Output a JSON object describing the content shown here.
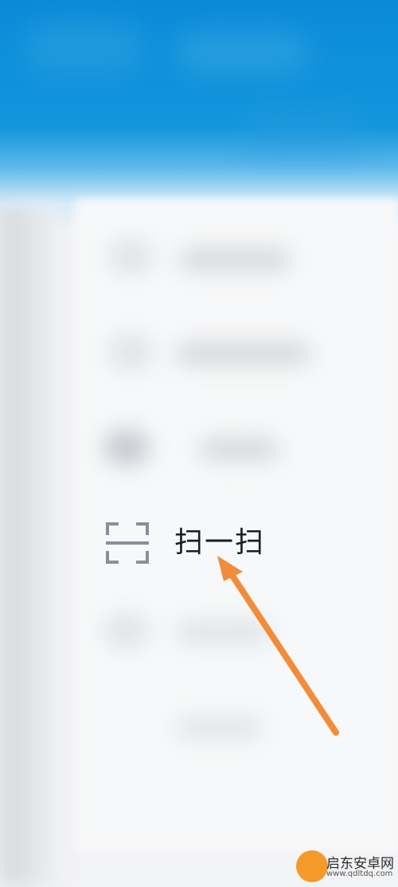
{
  "menu": {
    "scan_label": "扫一扫",
    "scan_icon": "scan-icon"
  },
  "annotation": {
    "arrow_color": "#f28c3a"
  },
  "watermark": {
    "brand": "启东安卓网",
    "url": "www.qdltdq.com"
  },
  "colors": {
    "header": "#0a8ad8",
    "background": "#f2f3f5",
    "text": "#1c1d21",
    "icon": "#8a8f9a"
  }
}
